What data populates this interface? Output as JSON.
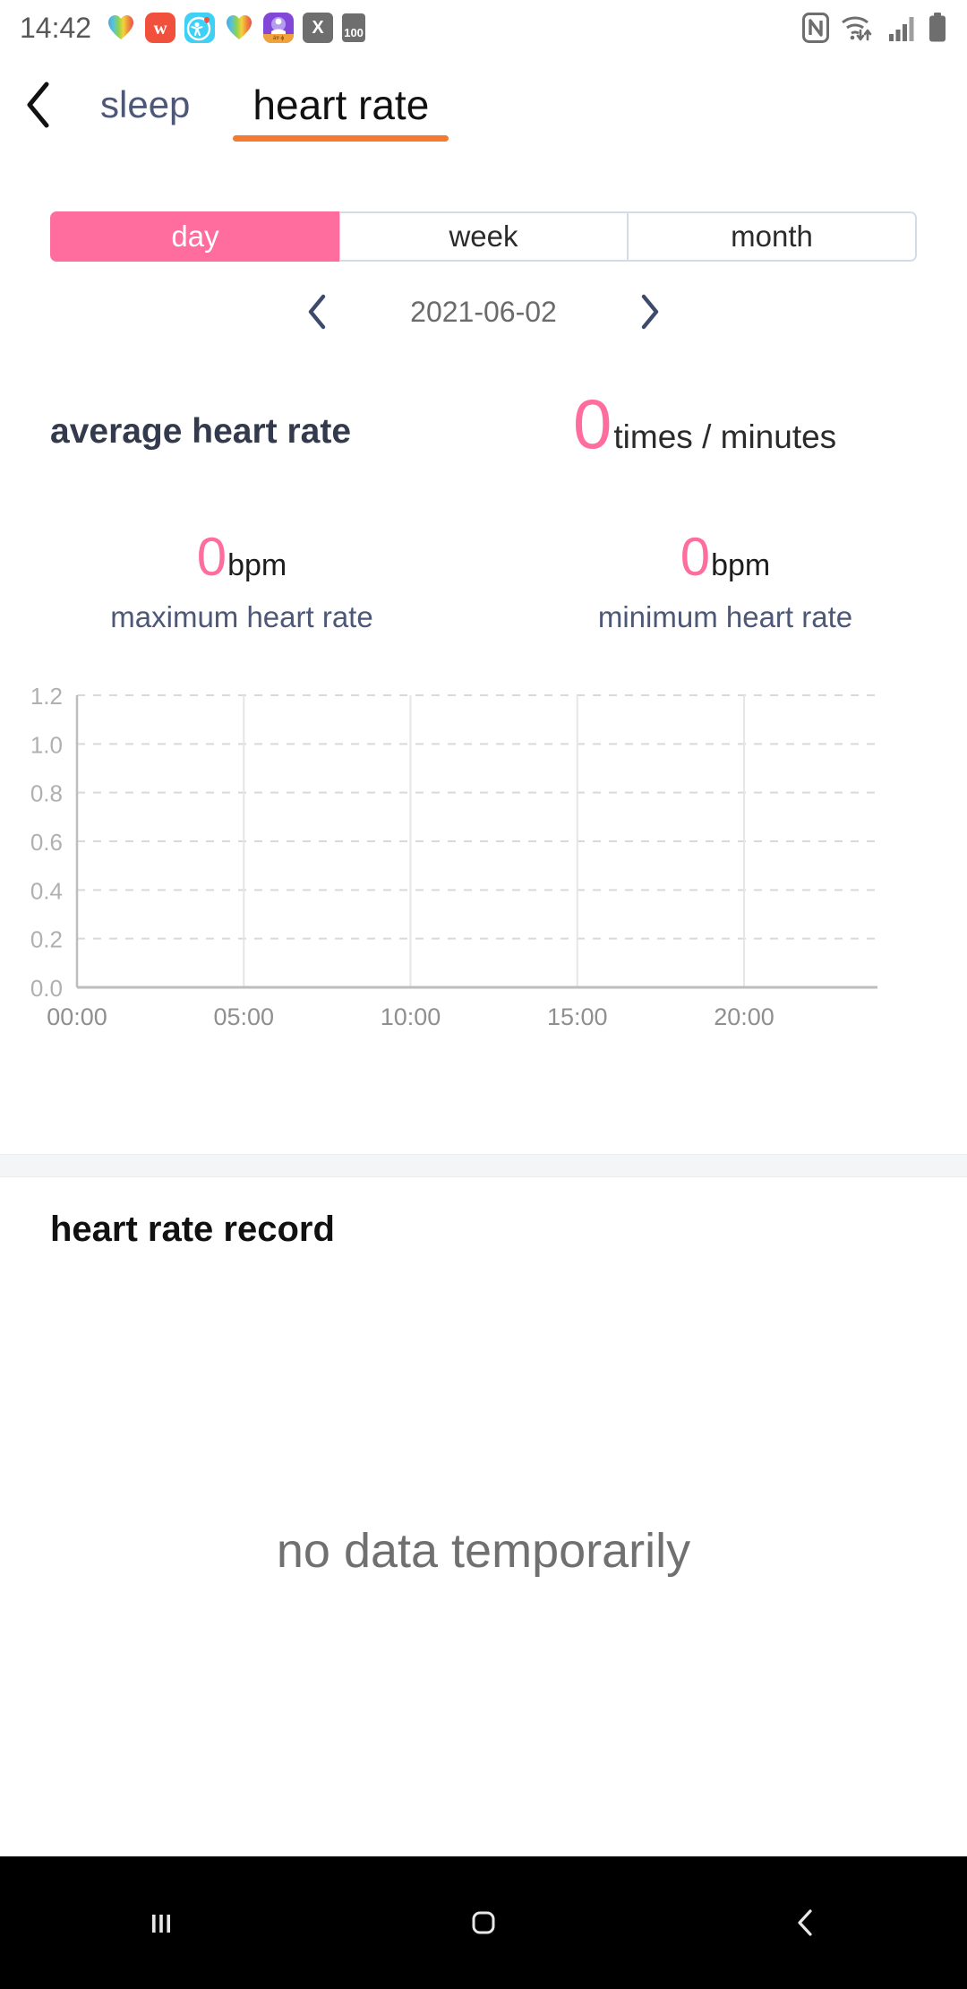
{
  "status_bar": {
    "time": "14:42",
    "left_icons": [
      {
        "name": "rainbow-heart-app-icon",
        "label": ""
      },
      {
        "name": "weibo-app-icon",
        "label": "w"
      },
      {
        "name": "health-person-app-icon",
        "label": ""
      },
      {
        "name": "rainbow-heart-app-icon-2",
        "label": ""
      },
      {
        "name": "purple-app-icon",
        "label": "áɤ·ɸ"
      },
      {
        "name": "sim-x-icon",
        "label": "X"
      },
      {
        "name": "battery-100-icon",
        "label": "100"
      }
    ],
    "right_icons": [
      {
        "name": "nfc-icon"
      },
      {
        "name": "wifi-transfer-icon"
      },
      {
        "name": "cellular-signal-icon"
      },
      {
        "name": "battery-icon"
      }
    ]
  },
  "nav": {
    "back_label": "‹",
    "tabs": [
      {
        "label": "sleep",
        "active": false
      },
      {
        "label": "heart rate",
        "active": true
      }
    ],
    "active_underline_color": "#f47b32"
  },
  "range_segment": {
    "options": [
      "day",
      "week",
      "month"
    ],
    "selected": "day",
    "active_color": "#ff6d9e"
  },
  "date_nav": {
    "prev_label": "‹",
    "next_label": "›",
    "date": "2021-06-02"
  },
  "summary": {
    "average": {
      "label": "average heart rate",
      "value": "0",
      "unit": "times / minutes"
    },
    "maximum": {
      "value": "0",
      "unit": "bpm",
      "label": "maximum heart rate"
    },
    "minimum": {
      "value": "0",
      "unit": "bpm",
      "label": "minimum heart rate"
    },
    "value_color": "#ff6d9e"
  },
  "record_section": {
    "title": "heart rate record",
    "empty_message": "no data temporarily"
  },
  "bottom_nav": {
    "recents_label": "|||",
    "home_label": "○",
    "back_label": "‹"
  },
  "chart_data": {
    "type": "line",
    "title": "",
    "xlabel": "",
    "ylabel": "",
    "x_tick_labels": [
      "00:00",
      "05:00",
      "10:00",
      "15:00",
      "20:00"
    ],
    "x_tick_values": [
      0,
      5,
      10,
      15,
      20
    ],
    "xlim": [
      0,
      24
    ],
    "y_tick_labels": [
      "0.0",
      "0.2",
      "0.4",
      "0.6",
      "0.8",
      "1.0",
      "1.2"
    ],
    "y_tick_values": [
      0.0,
      0.2,
      0.4,
      0.6,
      0.8,
      1.0,
      1.2
    ],
    "ylim": [
      0,
      1.2
    ],
    "grid": true,
    "grid_style": "dashed",
    "grid_color": "#d9d9d9",
    "axis_color": "#bdbdbd",
    "tick_label_color": "#b0b0b0",
    "legend": [],
    "series": [
      {
        "name": "heart rate",
        "x": [],
        "values": []
      }
    ]
  }
}
